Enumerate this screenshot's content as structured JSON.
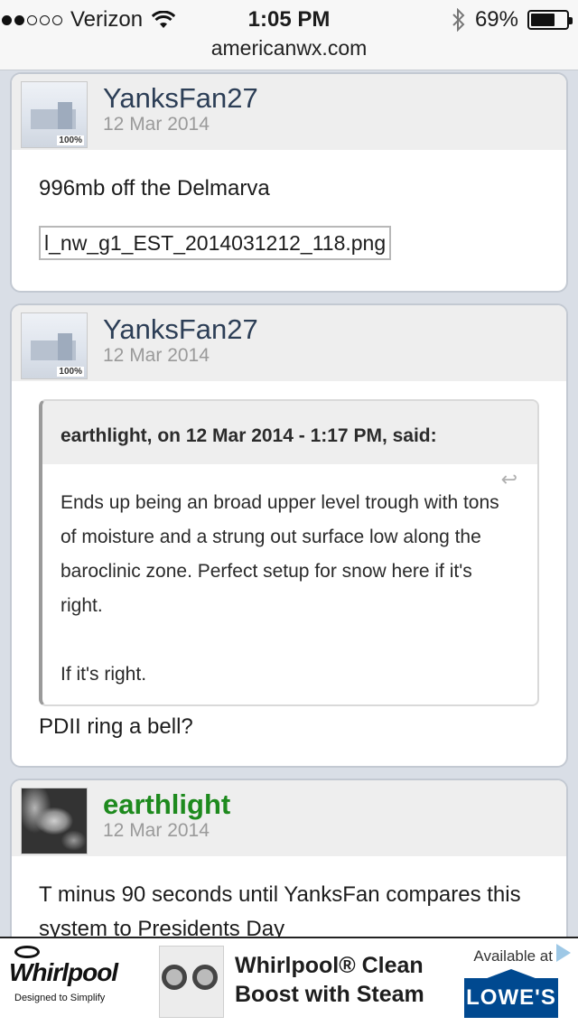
{
  "status_bar": {
    "carrier": "Verizon",
    "time": "1:05 PM",
    "battery": "69%",
    "battery_level": 0.69,
    "signal_bars_filled": 2,
    "signal_bars_total": 5
  },
  "browser": {
    "url": "americanwx.com"
  },
  "posts": [
    {
      "username": "YanksFan27",
      "date": "12 Mar 2014",
      "avatar_badge": "100%",
      "text": "996mb off the Delmarva",
      "attachment": "l_nw_g1_EST_2014031212_118.png"
    },
    {
      "username": "YanksFan27",
      "date": "12 Mar 2014",
      "avatar_badge": "100%",
      "quote": {
        "header": "earthlight, on 12 Mar 2014 - 1:17 PM, said:",
        "paragraph1": "Ends up being an broad upper level trough with tons of moisture and a strung out surface low along the baroclinic zone. Perfect setup for snow here if it's right.",
        "paragraph2": "If it's right."
      },
      "text": "PDII ring a bell?"
    },
    {
      "username": "earthlight",
      "date": "12 Mar 2014",
      "username_color": "#1e8a1e",
      "text": "T minus 90 seconds until YanksFan compares this system to Presidents Day"
    }
  ],
  "ad": {
    "brand": "Whirlpool",
    "tagline": "Designed to Simplify",
    "headline_line1": "Whirlpool® Clean",
    "headline_line2": "Boost with Steam",
    "available": "Available at",
    "retailer": "LOWE'S"
  }
}
